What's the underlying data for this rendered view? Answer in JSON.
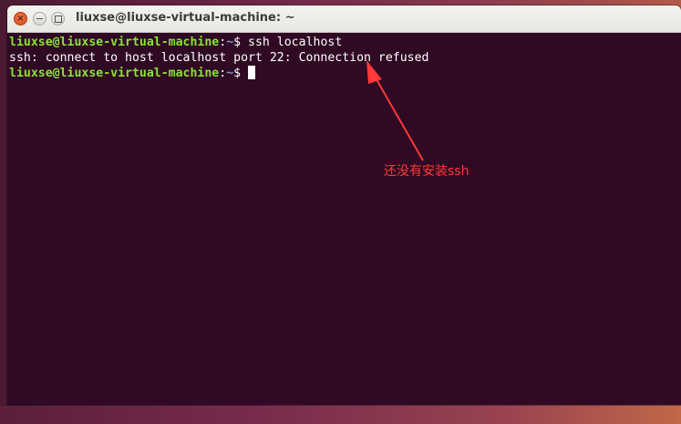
{
  "window": {
    "title": "liuxse@liuxse-virtual-machine: ~",
    "close_glyph": "×"
  },
  "terminal": {
    "lines": [
      {
        "user_host": "liuxse@liuxse-virtual-machine",
        "sep": ":",
        "path": "~",
        "prompt_char": "$ ",
        "command": "ssh localhost"
      },
      {
        "output": "ssh: connect to host localhost port 22: Connection refused"
      },
      {
        "user_host": "liuxse@liuxse-virtual-machine",
        "sep": ":",
        "path": "~",
        "prompt_char": "$ ",
        "command": ""
      }
    ]
  },
  "annotation": {
    "text": "还没有安装ssh",
    "color": "#ff3838"
  },
  "colors": {
    "terminal_bg": "#300a24",
    "prompt_user": "#8ae234",
    "prompt_path": "#729fcf",
    "close_button": "#e05a2b"
  },
  "icons": {
    "close": "close-icon",
    "minimize": "minimize-icon",
    "maximize": "maximize-icon"
  }
}
